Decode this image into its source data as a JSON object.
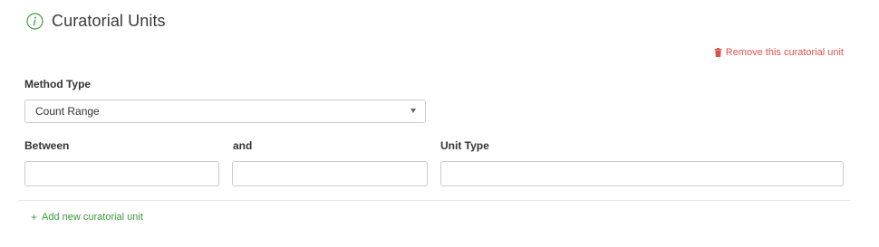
{
  "section": {
    "title": "Curatorial Units",
    "icon": "info-icon",
    "accent_color": "#3a9a3a"
  },
  "remove_action": {
    "label": "Remove this curatorial unit",
    "icon": "trash-icon",
    "color": "#d9534f"
  },
  "method_type": {
    "label": "Method Type",
    "selected": "Count Range"
  },
  "fields": {
    "between": {
      "label": "Between",
      "value": ""
    },
    "and": {
      "label": "and",
      "value": ""
    },
    "unit_type": {
      "label": "Unit Type",
      "value": ""
    }
  },
  "add_action": {
    "label": "Add new curatorial unit",
    "icon": "plus-icon",
    "color": "#3a9a3a"
  }
}
